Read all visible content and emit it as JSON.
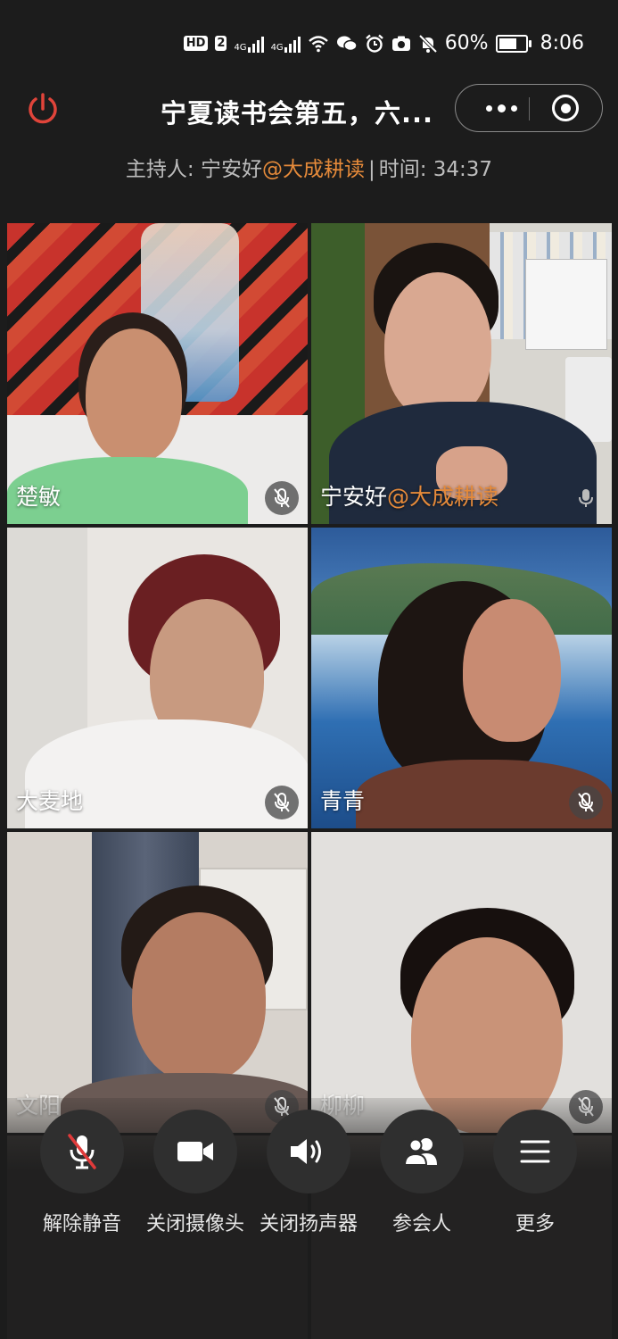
{
  "status_bar": {
    "hd_badge": "HD",
    "hd_sub": "2",
    "net1": "4G",
    "net2": "4G",
    "battery": "60%",
    "time": "8:06"
  },
  "header": {
    "title": "宁夏读书会第五，六...",
    "host_label": "主持人: ",
    "host_name": "宁安好",
    "host_org": "@大成耕读",
    "separator": "|",
    "time_label": "时间: ",
    "elapsed": "34:37"
  },
  "participants": [
    {
      "name": "楚敏",
      "org": "",
      "muted": true
    },
    {
      "name": "宁安好",
      "org": "@大成耕读",
      "muted": false
    },
    {
      "name": "大麦地",
      "org": "",
      "muted": true
    },
    {
      "name": "青青",
      "org": "",
      "muted": true
    },
    {
      "name": "文阳",
      "org": "",
      "muted": true
    },
    {
      "name": "柳柳",
      "org": "",
      "muted": true
    }
  ],
  "controls": [
    {
      "label": "解除静音",
      "icon": "mic-off-icon"
    },
    {
      "label": "关闭摄像头",
      "icon": "camera-icon"
    },
    {
      "label": "关闭扬声器",
      "icon": "speaker-icon"
    },
    {
      "label": "参会人",
      "icon": "participants-icon"
    },
    {
      "label": "更多",
      "icon": "menu-icon"
    }
  ],
  "colors": {
    "accent_orange": "#e58a3a",
    "power_red": "#e0443a",
    "mute_red": "#e03a3a"
  }
}
